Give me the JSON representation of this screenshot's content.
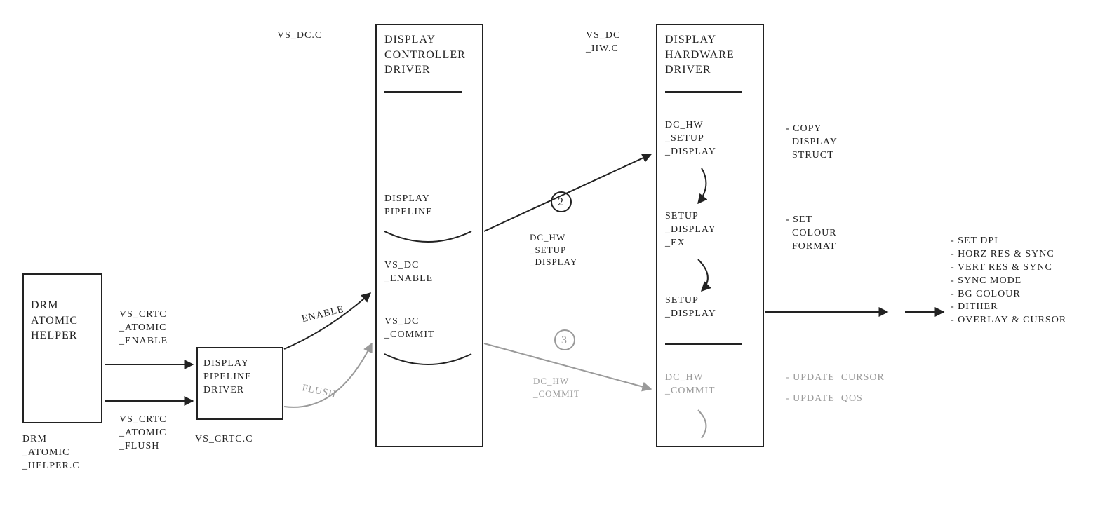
{
  "boxes": {
    "drm_helper": {
      "title": "DRM\nATOMIC\nHELPER"
    },
    "pipeline_driver": {
      "title": "DISPLAY\nPIPELINE\nDRIVER"
    },
    "controller_driver": {
      "title": "DISPLAY\nCONTROLLER\nDRIVER",
      "items": {
        "pipeline": "DISPLAY\nPIPELINE",
        "enable": "VS_DC\n_ENABLE",
        "commit": "VS_DC\n_COMMIT"
      }
    },
    "hardware_driver": {
      "title": "DISPLAY\nHARDWARE\nDRIVER",
      "items": {
        "setup_display": "DC_HW\n_SETUP\n_DISPLAY",
        "setup_display_ex": "SETUP\n_DISPLAY\n_EX",
        "setup_display2": "SETUP\n_DISPLAY",
        "commit": "DC_HW\n_COMMIT"
      }
    }
  },
  "file_labels": {
    "drm_helper": "DRM\n_ATOMIC\n_HELPER.C",
    "pipeline_driver": "VS_CRTC.C",
    "controller_driver": "VS_DC.C",
    "hardware_driver": "VS_DC\n_HW.C"
  },
  "edge_labels": {
    "to_pipeline_enable": "VS_CRTC\n_ATOMIC\n_ENABLE",
    "to_pipeline_flush": "VS_CRTC\n_ATOMIC\n_FLUSH",
    "pipeline_to_enable": "ENABLE",
    "pipeline_to_commit": "FLUSH",
    "to_hw_setup": "DC_HW\n_SETUP\n_DISPLAY",
    "to_hw_commit": "DC_HW\n_COMMIT"
  },
  "step_labels": {
    "two": "2",
    "three": "3"
  },
  "annotations": {
    "copy_struct": "- COPY\n  DISPLAY\n  STRUCT",
    "colour_format": "- SET\n  COLOUR\n  FORMAT",
    "update_cursor": "- UPDATE  CURSOR",
    "update_qos": "- UPDATE  QOS",
    "setup_display_out": "- SET DPI\n- HORZ RES & SYNC\n- VERT RES & SYNC\n- SYNC MODE\n- BG COLOUR\n- DITHER\n- OVERLAY & CURSOR"
  }
}
